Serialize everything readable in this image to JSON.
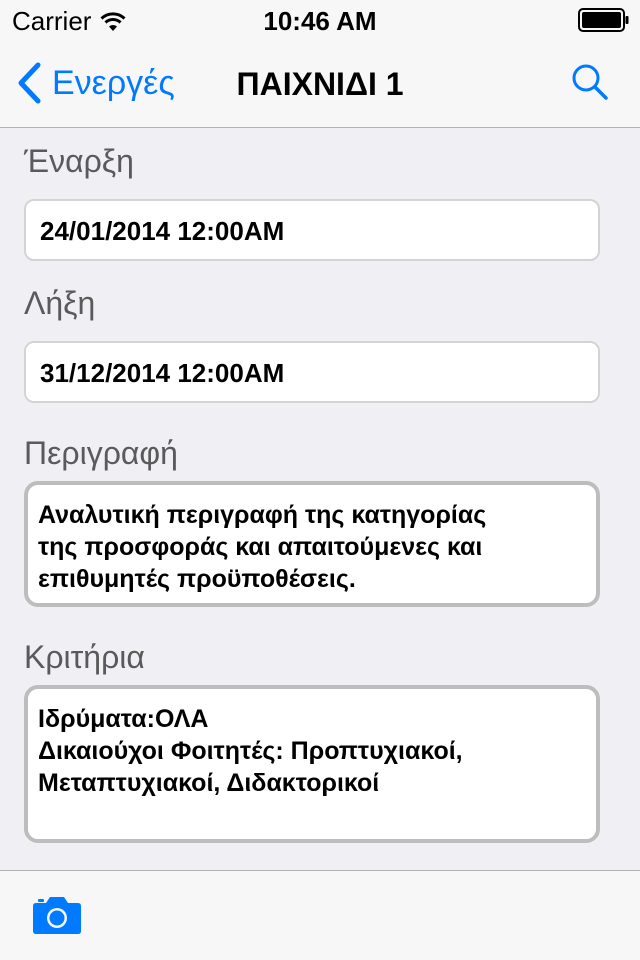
{
  "status": {
    "carrier": "Carrier",
    "time": "10:46 AM"
  },
  "nav": {
    "back_label": "Ενεργές",
    "title": "ΠΑΙΧΝΙΔΙ 1"
  },
  "form": {
    "start_label": "Έναρξη",
    "start_value": "24/01/2014 12:00AM",
    "end_label": "Λήξη",
    "end_value": "31/12/2014 12:00AM",
    "description_label": "Περιγραφή",
    "description_lines": [
      "Αναλυτική περιγραφή της κατηγορίας",
      "της προσφοράς και απαιτούμενες και",
      "επιθυμητές προϋποθέσεις."
    ],
    "criteria_label": "Κριτήρια",
    "criteria_lines": [
      "Ιδρύματα:ΟΛΑ",
      "Δικαιούχοι Φοιτητές: Προπτυχιακοί,",
      "Μεταπτυχιακοί, Διδακτορικοί"
    ]
  },
  "icons": {
    "wifi": "wifi-icon",
    "battery": "battery-icon",
    "back": "chevron-left-icon",
    "search": "search-icon",
    "camera": "camera-icon"
  },
  "colors": {
    "accent": "#007aff",
    "background": "#efeff4",
    "bar": "#f7f7f7"
  }
}
